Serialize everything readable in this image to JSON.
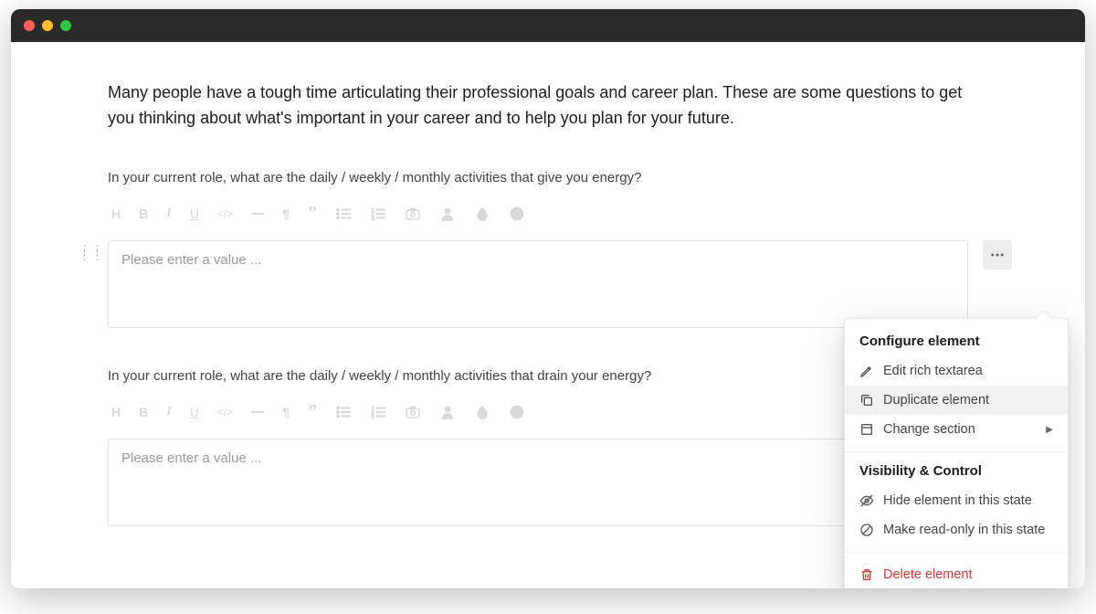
{
  "intro": "Many people have a tough time articulating their professional goals and career plan. These are some questions to get you thinking about what's important in your career and to help you plan for your future.",
  "questions": [
    {
      "label": "In your current role, what are the daily / weekly / monthly activities that give you energy?",
      "placeholder": "Please enter a value ..."
    },
    {
      "label": "In your current role, what are the daily / weekly / monthly activities that drain your energy?",
      "placeholder": "Please enter a value ..."
    }
  ],
  "toolbar_icons": [
    "heading",
    "bold",
    "italic",
    "underline",
    "code",
    "divider",
    "paragraph",
    "quote",
    "bullet-list",
    "ordered-list",
    "camera",
    "user",
    "droplet",
    "smiley"
  ],
  "popover": {
    "configure_heading": "Configure element",
    "edit_label": "Edit rich textarea",
    "duplicate_label": "Duplicate element",
    "change_section_label": "Change section",
    "visibility_heading": "Visibility & Control",
    "hide_label": "Hide element in this state",
    "readonly_label": "Make read-only in this state",
    "delete_label": "Delete element"
  }
}
